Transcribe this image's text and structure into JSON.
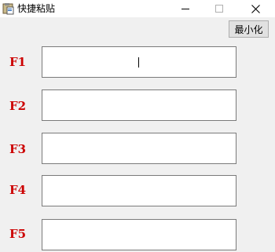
{
  "window": {
    "title": "快捷粘贴",
    "controls": {
      "minimize_icon": "minimize-icon",
      "maximize_icon": "maximize-icon",
      "close_icon": "close-icon"
    }
  },
  "toolbar": {
    "minimize_label": "最小化"
  },
  "fields": [
    {
      "label": "F1",
      "value": "",
      "focused": true
    },
    {
      "label": "F2",
      "value": ""
    },
    {
      "label": "F3",
      "value": ""
    },
    {
      "label": "F4",
      "value": ""
    },
    {
      "label": "F5",
      "value": ""
    }
  ],
  "colors": {
    "label_red": "#cc0000",
    "window_bg": "#f0f0f0"
  }
}
